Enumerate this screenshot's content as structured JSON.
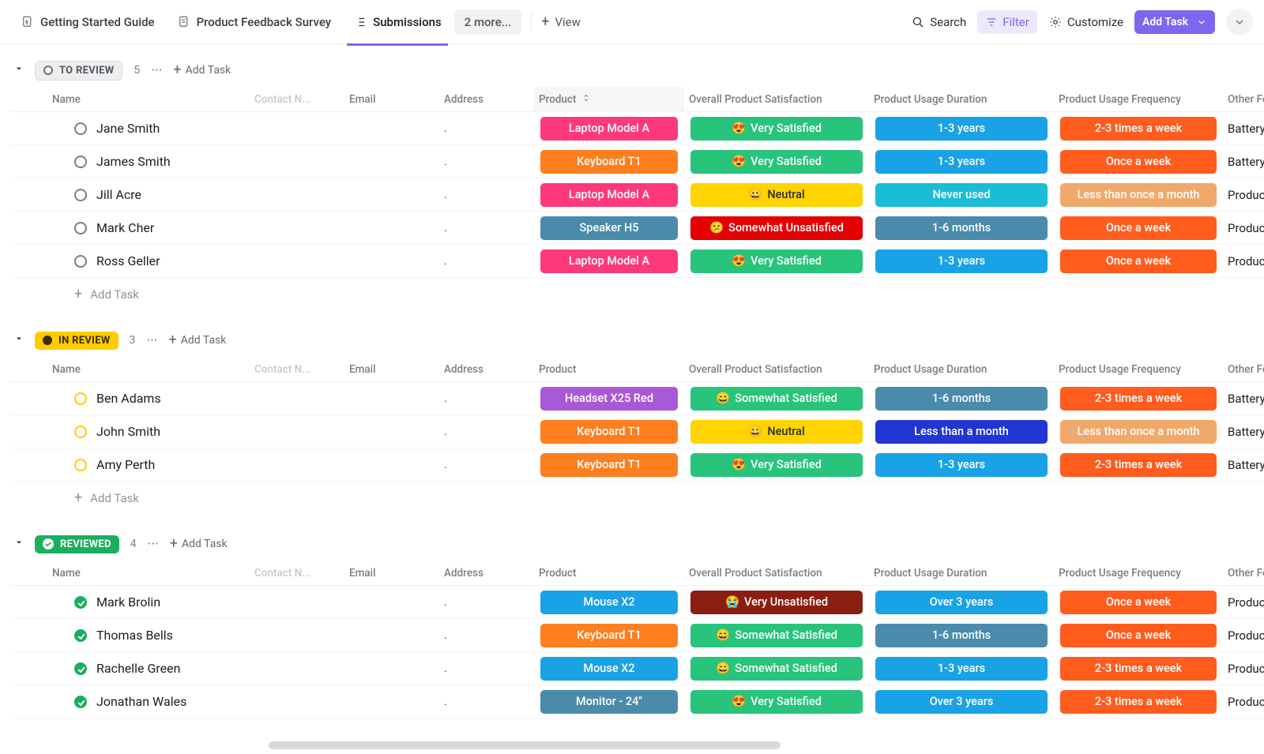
{
  "nav": {
    "tabs": [
      {
        "label": "Getting Started Guide",
        "active": false
      },
      {
        "label": "Product Feedback Survey",
        "active": false
      },
      {
        "label": "Submissions",
        "active": true
      }
    ],
    "more": "2 more...",
    "view": "View",
    "search": "Search",
    "filter": "Filter",
    "customize": "Customize",
    "addTask": "Add Task"
  },
  "columns": {
    "name": "Name",
    "contact": "Contact N...",
    "email": "Email",
    "address": "Address",
    "product": "Product",
    "satisfaction": "Overall Product Satisfaction",
    "duration": "Product Usage Duration",
    "frequency": "Product Usage Frequency",
    "feedback": "Other Feedbac"
  },
  "strings": {
    "addTaskInline": "Add Task"
  },
  "colors": {
    "pink": "#fd397a",
    "orange": "#ff7e1d",
    "teal": "#1bbcd5",
    "green": "#28c47b",
    "yellow": "#ffd400",
    "red": "#e20000",
    "darkred": "#8a1f11",
    "slate": "#4a8bab",
    "skyblue": "#1aa2e6",
    "royal": "#2336d4",
    "sand": "#f0a96b",
    "deepor": "#ff5c1e",
    "purple": "#aa59d6",
    "paleamber": "#ffcc00"
  },
  "groups": [
    {
      "id": "to-review",
      "label": "TO REVIEW",
      "count": 5,
      "chipClass": "to-review",
      "ring": "gray",
      "rows": [
        {
          "name": "Jane Smith",
          "address": ".",
          "product": {
            "text": "Laptop Model A",
            "colorKey": "pink"
          },
          "satisfaction": {
            "emoji": "😍",
            "text": "Very Satisfied",
            "colorKey": "green"
          },
          "duration": {
            "text": "1-3 years",
            "colorKey": "skyblue"
          },
          "frequency": {
            "text": "2-3 times a week",
            "colorKey": "deepor"
          },
          "feedback": "Battery lasts ..."
        },
        {
          "name": "James Smith",
          "address": ".",
          "product": {
            "text": "Keyboard T1",
            "colorKey": "orange"
          },
          "satisfaction": {
            "emoji": "😍",
            "text": "Very Satisfied",
            "colorKey": "green"
          },
          "duration": {
            "text": "1-3 years",
            "colorKey": "skyblue"
          },
          "frequency": {
            "text": "Once a week",
            "colorKey": "deepor"
          },
          "feedback": "Battery lasts ..."
        },
        {
          "name": "Jill Acre",
          "address": ".",
          "product": {
            "text": "Laptop Model A",
            "colorKey": "pink"
          },
          "satisfaction": {
            "emoji": "😀",
            "text": "Neutral",
            "colorKey": "yellow",
            "darkText": true
          },
          "duration": {
            "text": "Never used",
            "colorKey": "teal"
          },
          "frequency": {
            "text": "Less than once a month",
            "colorKey": "sand"
          },
          "feedback": "Product is wor..."
        },
        {
          "name": "Mark Cher",
          "address": ".",
          "product": {
            "text": "Speaker H5",
            "colorKey": "slate"
          },
          "satisfaction": {
            "emoji": "😕",
            "text": "Somewhat Unsatisfied",
            "colorKey": "red"
          },
          "duration": {
            "text": "1-6 months",
            "colorKey": "slate"
          },
          "frequency": {
            "text": "Once a week",
            "colorKey": "deepor"
          },
          "feedback": "Product is wor..."
        },
        {
          "name": "Ross Geller",
          "address": ".",
          "product": {
            "text": "Laptop Model A",
            "colorKey": "pink"
          },
          "satisfaction": {
            "emoji": "😍",
            "text": "Very Satisfied",
            "colorKey": "green"
          },
          "duration": {
            "text": "1-3 years",
            "colorKey": "skyblue"
          },
          "frequency": {
            "text": "Once a week",
            "colorKey": "deepor"
          },
          "feedback": "Product is wor..."
        }
      ]
    },
    {
      "id": "in-review",
      "label": "IN REVIEW",
      "count": 3,
      "chipClass": "in-review",
      "ring": "yellow",
      "rows": [
        {
          "name": "Ben Adams",
          "address": ".",
          "product": {
            "text": "Headset X25 Red",
            "colorKey": "purple"
          },
          "satisfaction": {
            "emoji": "😄",
            "text": "Somewhat Satisfied",
            "colorKey": "green"
          },
          "duration": {
            "text": "1-6 months",
            "colorKey": "slate"
          },
          "frequency": {
            "text": "2-3 times a week",
            "colorKey": "deepor"
          },
          "feedback": "Battery lasts ..."
        },
        {
          "name": "John Smith",
          "address": ".",
          "product": {
            "text": "Keyboard T1",
            "colorKey": "orange"
          },
          "satisfaction": {
            "emoji": "😀",
            "text": "Neutral",
            "colorKey": "yellow",
            "darkText": true
          },
          "duration": {
            "text": "Less than a month",
            "colorKey": "royal"
          },
          "frequency": {
            "text": "Less than once a month",
            "colorKey": "sand"
          },
          "feedback": "Battery lasts ..."
        },
        {
          "name": "Amy Perth",
          "address": ".",
          "product": {
            "text": "Keyboard T1",
            "colorKey": "orange"
          },
          "satisfaction": {
            "emoji": "😍",
            "text": "Very Satisfied",
            "colorKey": "green"
          },
          "duration": {
            "text": "1-3 years",
            "colorKey": "skyblue"
          },
          "frequency": {
            "text": "2-3 times a week",
            "colorKey": "deepor"
          },
          "feedback": "Battery lasts ..."
        }
      ]
    },
    {
      "id": "reviewed",
      "label": "REVIEWED",
      "count": 4,
      "chipClass": "reviewed",
      "ring": "green",
      "rows": [
        {
          "name": "Mark Brolin",
          "address": ".",
          "product": {
            "text": "Mouse X2",
            "colorKey": "skyblue"
          },
          "satisfaction": {
            "emoji": "😭",
            "text": "Very Unsatisfied",
            "colorKey": "darkred"
          },
          "duration": {
            "text": "Over 3 years",
            "colorKey": "skyblue"
          },
          "frequency": {
            "text": "Once a week",
            "colorKey": "deepor"
          },
          "feedback": "Product is wor..."
        },
        {
          "name": "Thomas Bells",
          "address": ".",
          "product": {
            "text": "Keyboard T1",
            "colorKey": "orange"
          },
          "satisfaction": {
            "emoji": "😄",
            "text": "Somewhat Satisfied",
            "colorKey": "green"
          },
          "duration": {
            "text": "1-6 months",
            "colorKey": "slate"
          },
          "frequency": {
            "text": "Once a week",
            "colorKey": "deepor"
          },
          "feedback": "Product is wor..."
        },
        {
          "name": "Rachelle Green",
          "address": ".",
          "product": {
            "text": "Mouse X2",
            "colorKey": "skyblue"
          },
          "satisfaction": {
            "emoji": "😄",
            "text": "Somewhat Satisfied",
            "colorKey": "green"
          },
          "duration": {
            "text": "1-3 years",
            "colorKey": "skyblue"
          },
          "frequency": {
            "text": "2-3 times a week",
            "colorKey": "deepor"
          },
          "feedback": "Product is wor..."
        },
        {
          "name": "Jonathan Wales",
          "address": ".",
          "product": {
            "text": "Monitor - 24\"",
            "colorKey": "slate"
          },
          "satisfaction": {
            "emoji": "😍",
            "text": "Very Satisfied",
            "colorKey": "green"
          },
          "duration": {
            "text": "Over 3 years",
            "colorKey": "skyblue"
          },
          "frequency": {
            "text": "2-3 times a week",
            "colorKey": "deepor"
          },
          "feedback": "Product is wor..."
        }
      ]
    }
  ]
}
